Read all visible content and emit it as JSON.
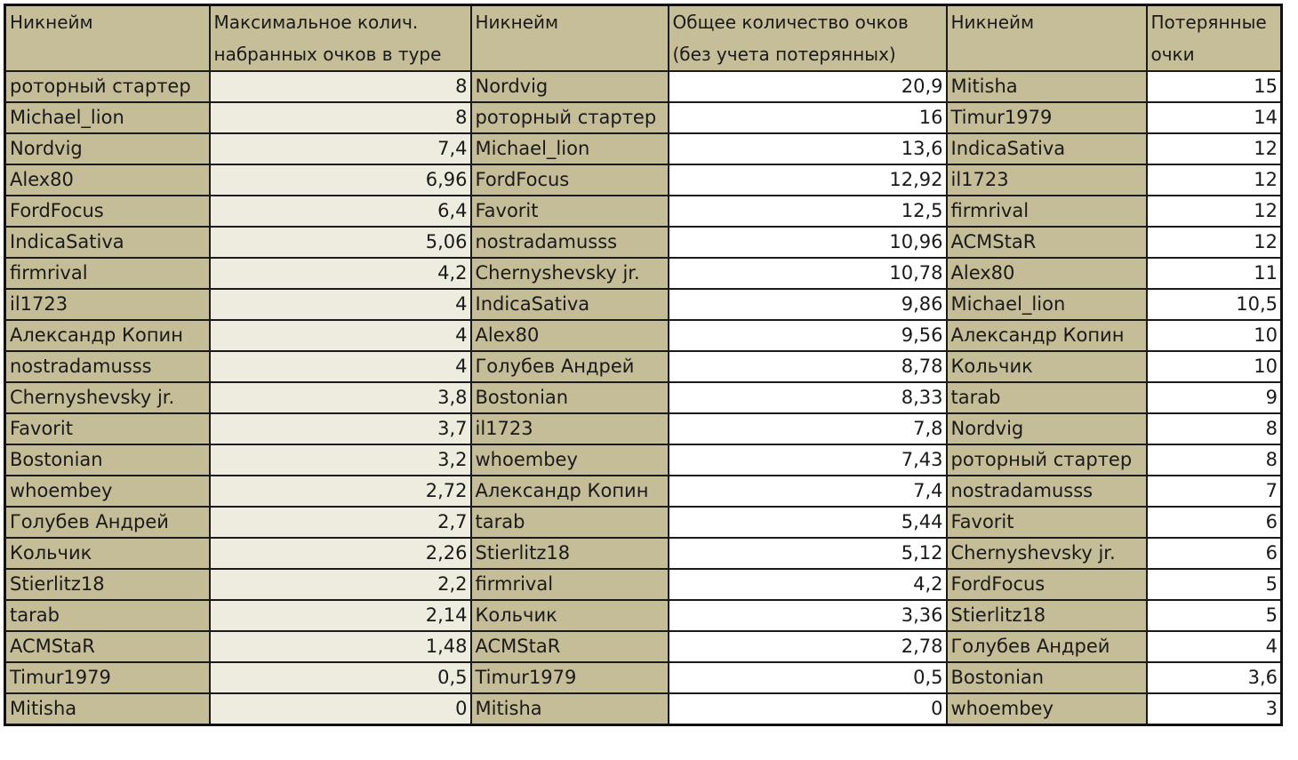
{
  "headers": [
    "Никнейм",
    "Максимальное колич. набранных очков в туре",
    "Никнейм",
    "Общее количество очков (без учета потерянных)",
    "Никнейм",
    "Потерянные очки"
  ],
  "rows": [
    [
      "роторный стартер",
      "8",
      "Nordvig",
      "20,9",
      "Mitisha",
      "15"
    ],
    [
      "Michael_lion",
      "8",
      "роторный стартер",
      "16",
      "Timur1979",
      "14"
    ],
    [
      "Nordvig",
      "7,4",
      "Michael_lion",
      "13,6",
      "IndicaSativa",
      "12"
    ],
    [
      "Alex80",
      "6,96",
      "FordFocus",
      "12,92",
      "il1723",
      "12"
    ],
    [
      "FordFocus",
      "6,4",
      "Favorit",
      "12,5",
      "firmrival",
      "12"
    ],
    [
      "IndicaSativa",
      "5,06",
      "nostradamusss",
      "10,96",
      "ACMStaR",
      "12"
    ],
    [
      "firmrival",
      "4,2",
      "Chernyshevsky jr.",
      "10,78",
      "Alex80",
      "11"
    ],
    [
      "il1723",
      "4",
      "IndicaSativa",
      "9,86",
      "Michael_lion",
      "10,5"
    ],
    [
      "Александр Копин",
      "4",
      "Alex80",
      "9,56",
      "Александр Копин",
      "10"
    ],
    [
      "nostradamusss",
      "4",
      "Голубев Андрей",
      "8,78",
      "Кольчик",
      "10"
    ],
    [
      "Chernyshevsky jr.",
      "3,8",
      "Bostonian",
      "8,33",
      "tarab",
      "9"
    ],
    [
      "Favorit",
      "3,7",
      "il1723",
      "7,8",
      "Nordvig",
      "8"
    ],
    [
      "Bostonian",
      "3,2",
      "whoembey",
      "7,43",
      "роторный стартер",
      "8"
    ],
    [
      "whoembey",
      "2,72",
      "Александр Копин",
      "7,4",
      "nostradamusss",
      "7"
    ],
    [
      "Голубев Андрей",
      "2,7",
      "tarab",
      "5,44",
      "Favorit",
      "6"
    ],
    [
      "Кольчик",
      "2,26",
      "Stierlitz18",
      "5,12",
      "Chernyshevsky jr.",
      "6"
    ],
    [
      "Stierlitz18",
      "2,2",
      "firmrival",
      "4,2",
      "FordFocus",
      "5"
    ],
    [
      "tarab",
      "2,14",
      "Кольчик",
      "3,36",
      "Stierlitz18",
      "5"
    ],
    [
      "ACMStaR",
      "1,48",
      "ACMStaR",
      "2,78",
      "Голубев Андрей",
      "4"
    ],
    [
      "Timur1979",
      "0,5",
      "Timur1979",
      "0,5",
      "Bostonian",
      "3,6"
    ],
    [
      "Mitisha",
      "0",
      "Mitisha",
      "0",
      "whoembey",
      "3"
    ]
  ]
}
